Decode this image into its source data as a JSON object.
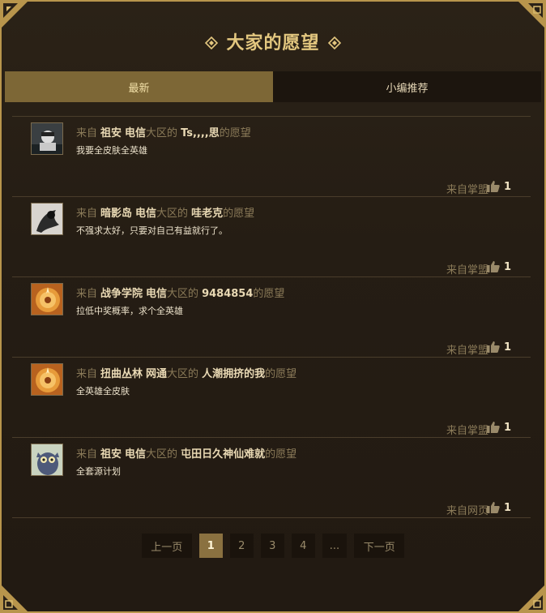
{
  "header": {
    "title": "大家的愿望"
  },
  "tabs": [
    {
      "label": "最新",
      "active": true
    },
    {
      "label": "小编推荐",
      "active": false
    }
  ],
  "common": {
    "from_prefix": "来自",
    "region_suffix": "大区的",
    "wish_suffix": "的愿望"
  },
  "items": [
    {
      "server": "祖安",
      "isp": "电信",
      "user": "Ts,,,,思",
      "wish": "我要全皮肤全英雄",
      "source": "来自掌盟",
      "likes": "1",
      "avatar": "dark-avatar"
    },
    {
      "server": "暗影岛",
      "isp": "电信",
      "user": "哇老克",
      "wish": "不强求太好，只要对自己有益就行了。",
      "source": "来自掌盟",
      "likes": "1",
      "avatar": "shadow-avatar"
    },
    {
      "server": "战争学院",
      "isp": "电信",
      "user": "9484854",
      "wish": "拉低中奖概率，求个全英雄",
      "source": "来自掌盟",
      "likes": "1",
      "avatar": "gold-avatar"
    },
    {
      "server": "扭曲丛林",
      "isp": "网通",
      "user": "人潮拥挤的我",
      "wish": "全英雄全皮肤",
      "source": "来自掌盟",
      "likes": "1",
      "avatar": "gold-avatar"
    },
    {
      "server": "祖安",
      "isp": "电信",
      "user": "屯田日久神仙难就",
      "wish": "全套源计划",
      "source": "来自网页",
      "likes": "1",
      "avatar": "cartoon-avatar"
    }
  ],
  "pagination": {
    "prev": "上一页",
    "pages": [
      "1",
      "2",
      "3",
      "4"
    ],
    "current": "1",
    "ellipsis": "...",
    "next": "下一页"
  },
  "colors": {
    "gold": "#e3c77f",
    "tab_active": "#7d6736",
    "border": "#b8954c"
  }
}
